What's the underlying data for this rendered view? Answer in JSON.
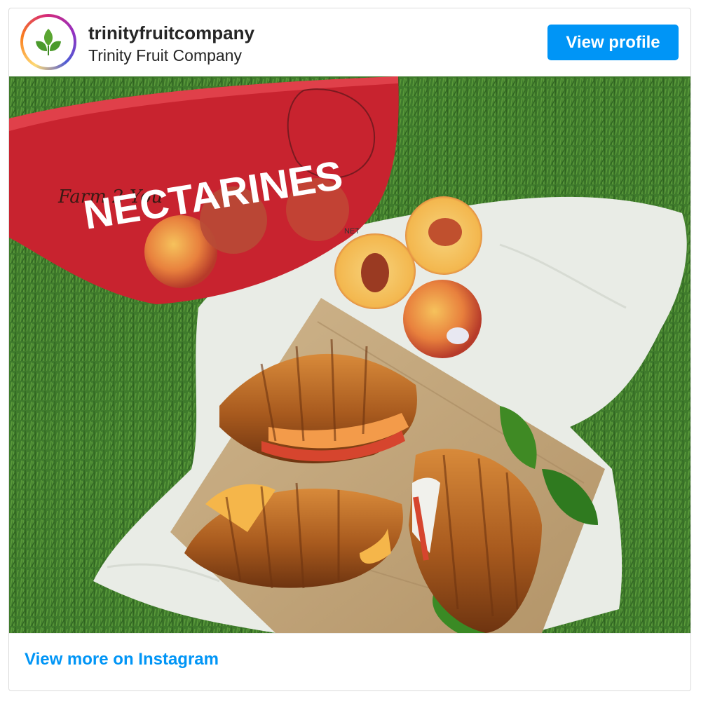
{
  "header": {
    "username": "trinityfruitcompany",
    "full_name": "Trinity Fruit Company",
    "avatar_icon": "leaf-sprout-logo-icon",
    "view_profile_label": "View profile",
    "button_color": "#0095f6"
  },
  "post": {
    "image_description_icon": "photo",
    "bag_brand": "Farm 2 You",
    "bag_label": "NECTARINES",
    "bag_small_text": "NET"
  },
  "footer": {
    "view_more_label": "View more on Instagram",
    "link_color": "#0095f6"
  }
}
